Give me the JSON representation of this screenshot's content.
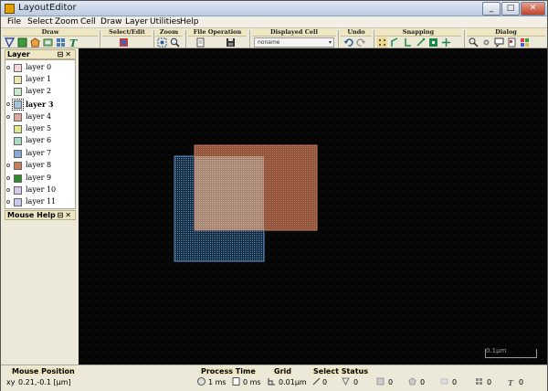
{
  "window": {
    "title": "LayoutEditor",
    "min": "_",
    "max": "□",
    "close": "✕"
  },
  "menu": [
    "File",
    "Select",
    "Zoom",
    "Cell",
    "Draw",
    "Layer",
    "Utilities",
    "Help"
  ],
  "toolbar": {
    "draw_label": "Draw",
    "select_label": "Select/Edit",
    "zoom_label": "Zoom",
    "file_label": "File Operation",
    "cell_label": "Displayed Cell",
    "cell_value": "noname",
    "undo_label": "Undo",
    "snap_label": "Snapping",
    "dialog_label": "Dialog"
  },
  "layer_panel": {
    "title": "Layer",
    "buttons": "⊟✕",
    "layers": [
      {
        "name": "layer 0",
        "color": "#f2d7d7"
      },
      {
        "name": "layer 1",
        "color": "#e8e8b0"
      },
      {
        "name": "layer 2",
        "color": "#cce8cc"
      },
      {
        "name": "layer 3",
        "color": "#a7c4dd",
        "selected": true
      },
      {
        "name": "layer 4",
        "color": "#e0a89a"
      },
      {
        "name": "layer 5",
        "color": "#dde88c"
      },
      {
        "name": "layer 6",
        "color": "#a8d8c8"
      },
      {
        "name": "layer 7",
        "color": "#88a8d8"
      },
      {
        "name": "layer 8",
        "color": "#c8805a"
      },
      {
        "name": "layer 9",
        "color": "#2e8a2e"
      },
      {
        "name": "layer 10",
        "color": "#d8c8e8"
      },
      {
        "name": "layer 11",
        "color": "#c8c8f0"
      }
    ]
  },
  "mouse_help": {
    "title": "Mouse Help",
    "buttons": "⊟✕"
  },
  "canvas": {
    "scale_text": "0.1μm",
    "colors": {
      "blue_box": "#5a8fbf",
      "orange_box": "#c07858"
    }
  },
  "status": {
    "mouse_position_label": "Mouse Position",
    "mouse_position_value": "0.21,-0.1 [μm]",
    "process_time_label": "Process Time",
    "process_time_1": "1 ms",
    "process_time_2": "0 ms",
    "grid_label": "Grid",
    "grid_value": "0.01μm",
    "select_status_label": "Select Status",
    "select_counts": [
      "0",
      "0",
      "0",
      "0",
      "0",
      "0",
      "0"
    ]
  }
}
